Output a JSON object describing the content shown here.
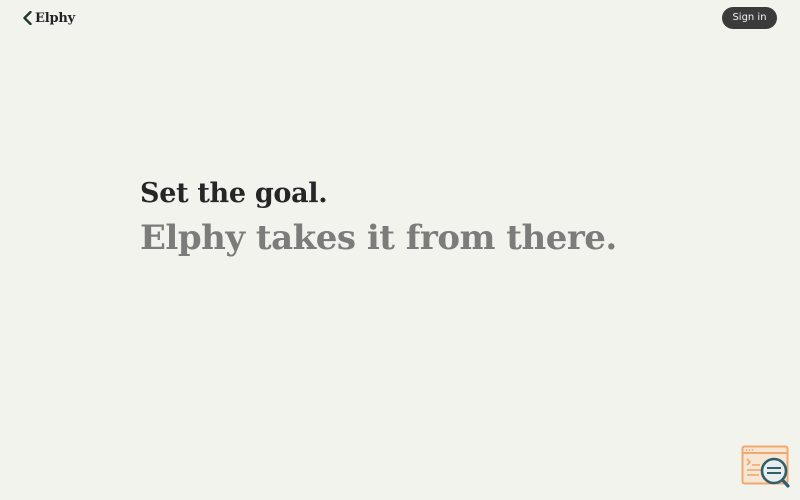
{
  "header": {
    "logo_text": "Elphy",
    "logo_icon": "chevron-left-icon",
    "signin_label": "Sign in"
  },
  "hero": {
    "line1": "Set the goal.",
    "line2": "Elphy takes it from there."
  },
  "widget": {
    "icon": "search-document-icon"
  },
  "colors": {
    "background": "#f3f3ee",
    "text_dark": "#262626",
    "text_muted": "#7c7c7a",
    "button_bg": "#3b3b3b",
    "widget_orange": "#f0a870",
    "widget_teal": "#2e5f6b"
  }
}
